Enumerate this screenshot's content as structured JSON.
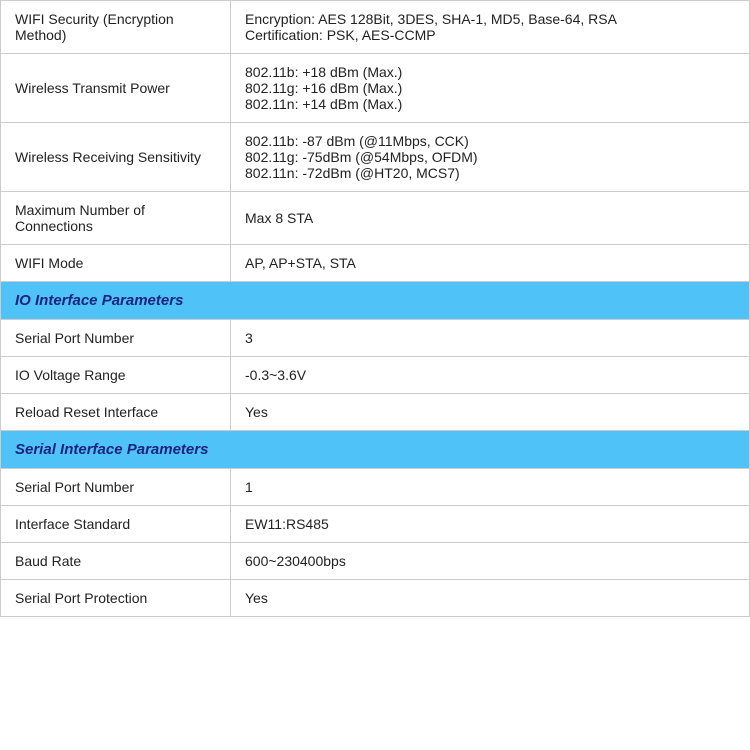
{
  "table": {
    "sections": [
      {
        "type": "rows",
        "rows": [
          {
            "label": "WIFI Security (Encryption Method)",
            "value": "Encryption: AES 128Bit, 3DES, SHA-1, MD5, Base-64, RSA\nCertification: PSK, AES-CCMP"
          },
          {
            "label": "Wireless Transmit Power",
            "value": "802.11b: +18 dBm (Max.)\n802.11g: +16 dBm (Max.)\n802.11n: +14 dBm (Max.)"
          },
          {
            "label": "Wireless Receiving Sensitivity",
            "value": "802.11b: -87 dBm (@11Mbps, CCK)\n802.11g: -75dBm (@54Mbps, OFDM)\n802.11n: -72dBm (@HT20, MCS7)"
          },
          {
            "label": "Maximum Number of Connections",
            "value": "Max 8 STA"
          },
          {
            "label": "WIFI Mode",
            "value": "AP, AP+STA, STA"
          }
        ]
      },
      {
        "type": "header",
        "label": "IO Interface Parameters"
      },
      {
        "type": "rows",
        "rows": [
          {
            "label": "Serial Port Number",
            "value": "3"
          },
          {
            "label": "IO Voltage Range",
            "value": "-0.3~3.6V"
          },
          {
            "label": "Reload Reset Interface",
            "value": "Yes"
          }
        ]
      },
      {
        "type": "header",
        "label": "Serial Interface Parameters"
      },
      {
        "type": "rows",
        "rows": [
          {
            "label": "Serial Port Number",
            "value": "1"
          },
          {
            "label": "Interface Standard",
            "value": "EW11:RS485"
          },
          {
            "label": "Baud Rate",
            "value": "600~230400bps"
          },
          {
            "label": "Serial Port Protection",
            "value": "Yes"
          }
        ]
      }
    ]
  }
}
